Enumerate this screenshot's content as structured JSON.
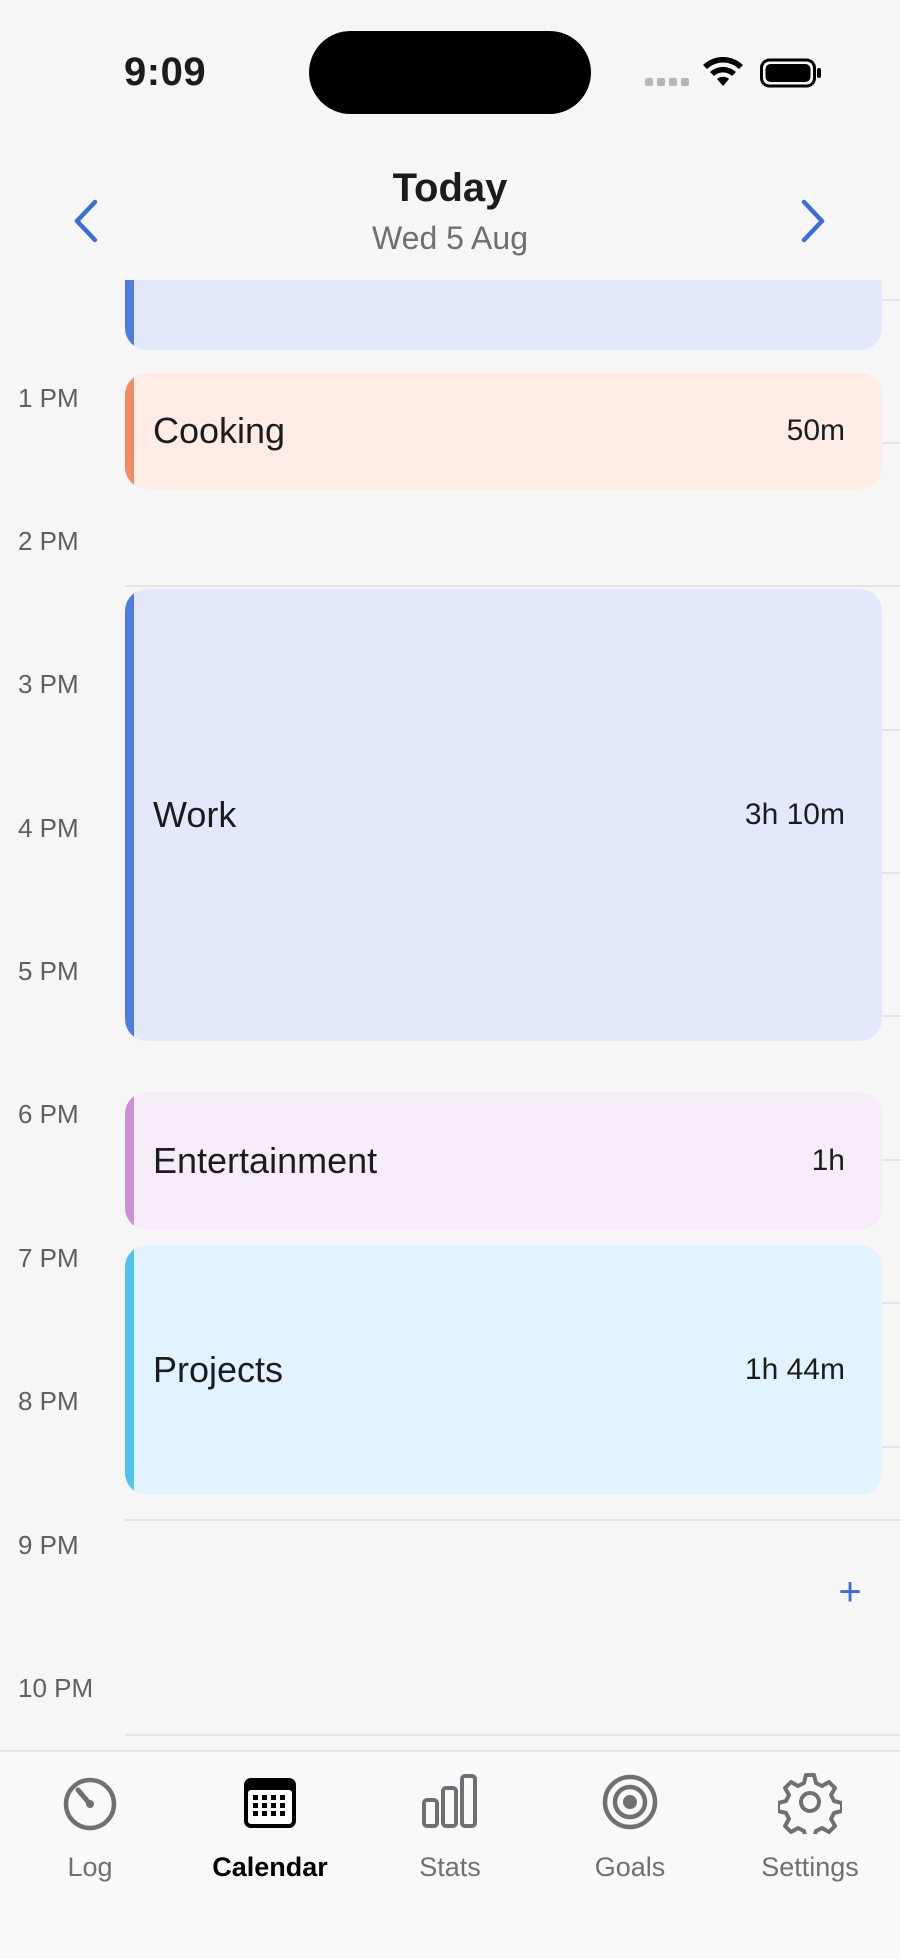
{
  "status_bar": {
    "time": "9:09"
  },
  "header": {
    "title": "Today",
    "date": "Wed 5 Aug"
  },
  "hours": [
    "1 PM",
    "2 PM",
    "3 PM",
    "4 PM",
    "5 PM",
    "6 PM",
    "7 PM",
    "8 PM",
    "9 PM",
    "10 PM"
  ],
  "events": [
    {
      "label": "",
      "duration": "",
      "color": "#4f7be3",
      "bg": "#e3e8fa"
    },
    {
      "label": "Cooking",
      "duration": "50m",
      "color": "#f28b66",
      "bg": "#fdebe6"
    },
    {
      "label": "Work",
      "duration": "3h 10m",
      "color": "#4f7be3",
      "bg": "#e3e8fa"
    },
    {
      "label": "Entertainment",
      "duration": "1h",
      "color": "#cc8fd7",
      "bg": "#f5ecf7"
    },
    {
      "label": "Projects",
      "duration": "1h 44m",
      "color": "#52c3ee",
      "bg": "#e3f3fd"
    }
  ],
  "add_button": "+",
  "tabs": [
    {
      "label": "Log",
      "icon": "gauge-icon"
    },
    {
      "label": "Calendar",
      "icon": "calendar-icon",
      "active": true
    },
    {
      "label": "Stats",
      "icon": "bar-chart-icon"
    },
    {
      "label": "Goals",
      "icon": "target-icon"
    },
    {
      "label": "Settings",
      "icon": "gear-icon"
    }
  ]
}
